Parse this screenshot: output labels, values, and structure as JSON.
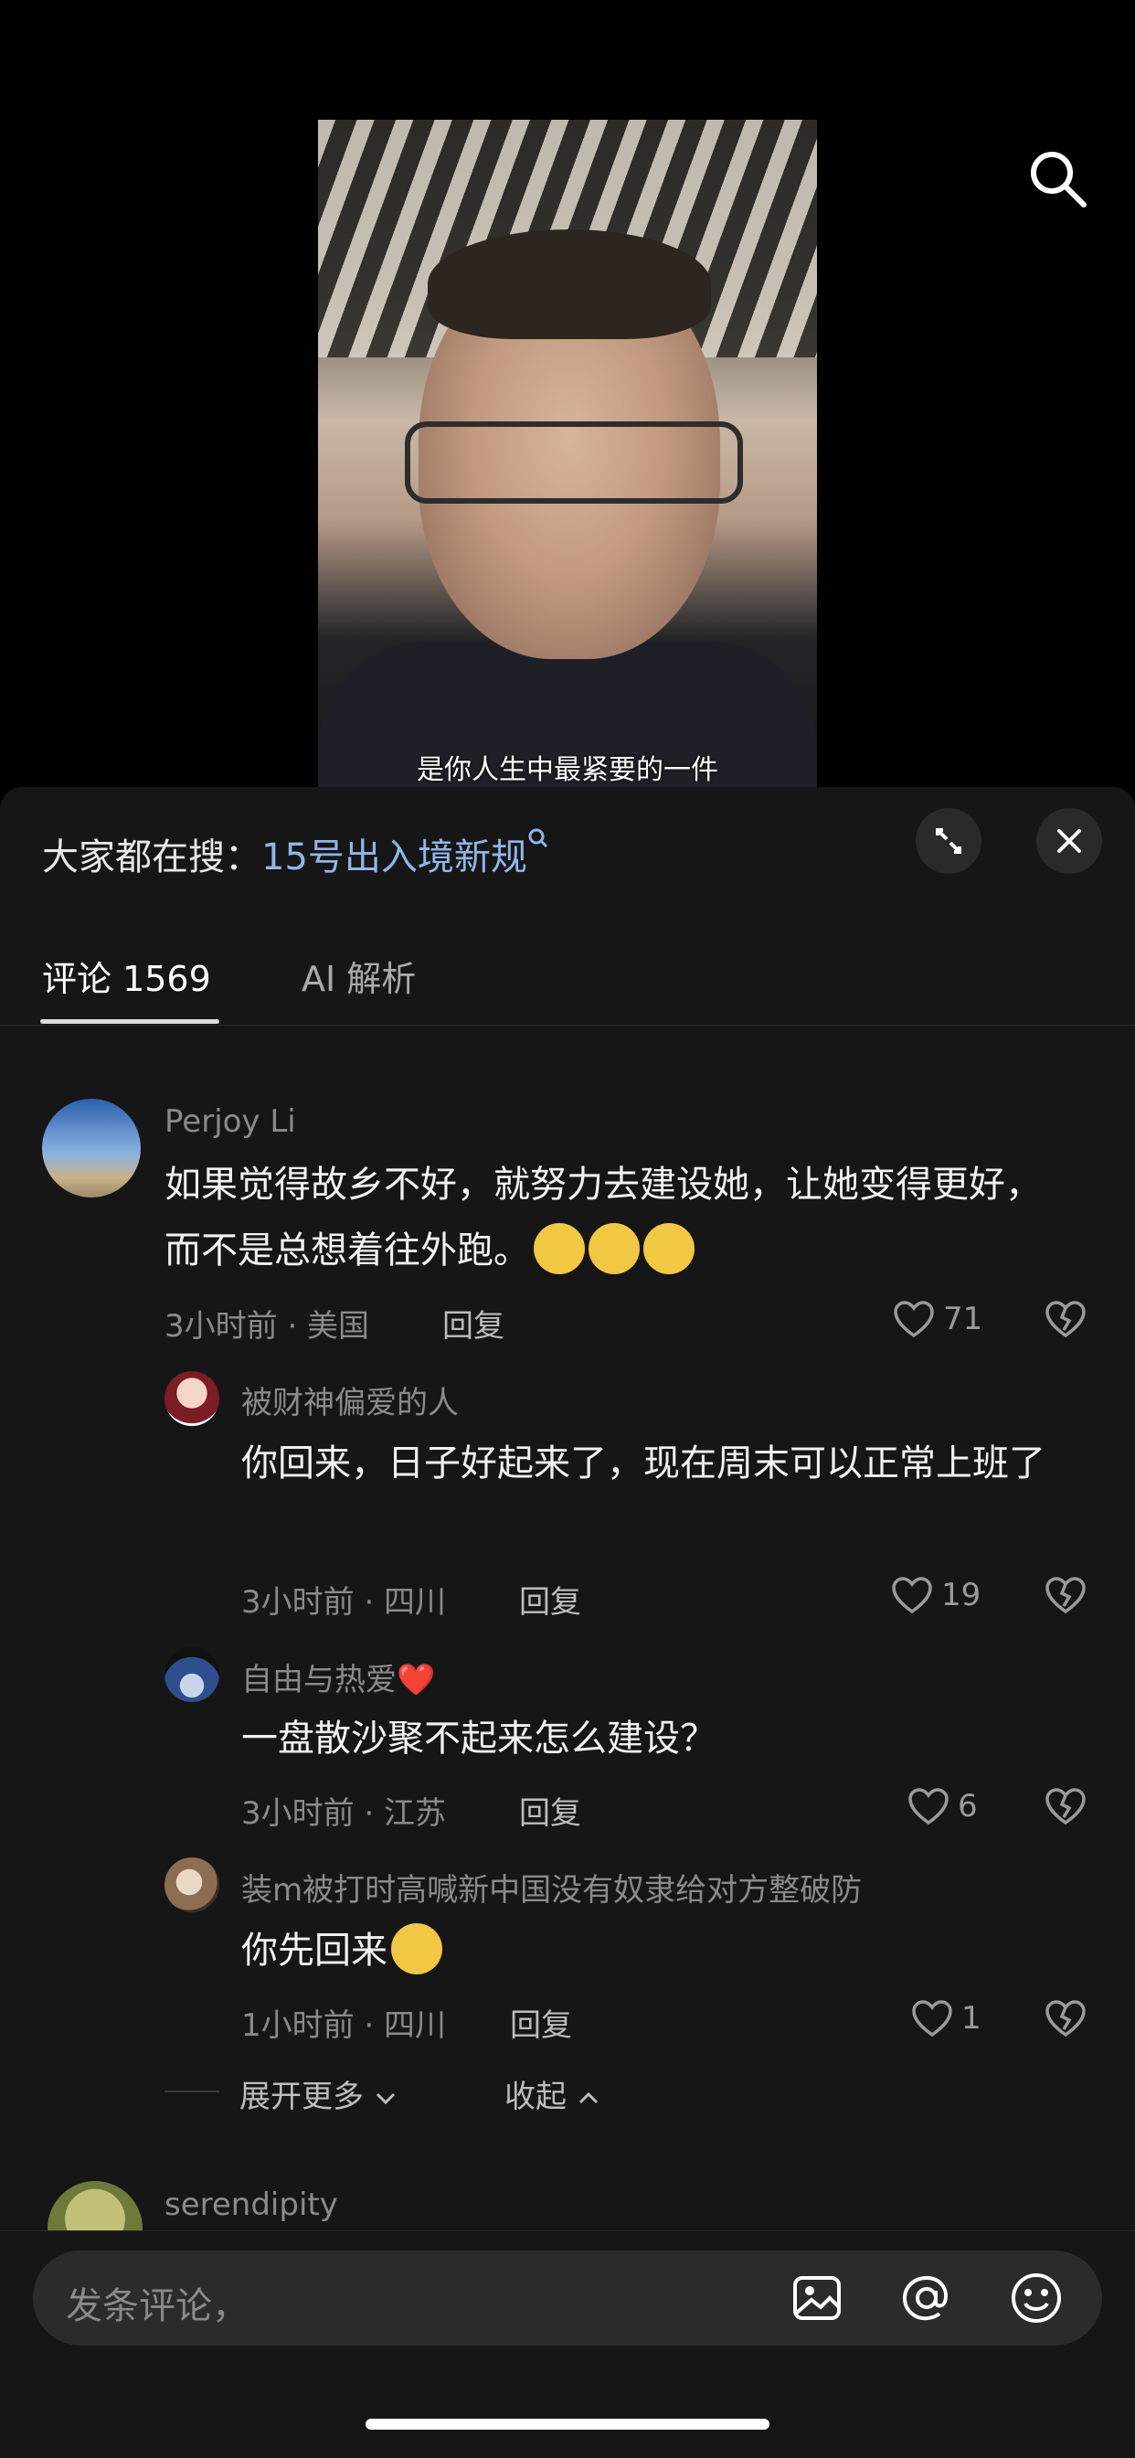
{
  "video": {
    "subtitle": "是你人生中最紧要的一件"
  },
  "trending": {
    "prefix": "大家都在搜：",
    "keyword": "15号出入境新规"
  },
  "tabs": {
    "comments": "评论 1569",
    "ai": "AI 解析"
  },
  "comments": [
    {
      "username": "Perjoy Li",
      "text": "如果觉得故乡不好，就努力去建设她，让她变得更好，而不是总想着往外跑。",
      "meta": "3小时前 · 美国",
      "reply": "回复",
      "likes": "71"
    },
    {
      "username": "被财神偏爱的人",
      "text": "你回来，日子好起来了，现在周末可以正常上班了",
      "meta": "3小时前 · 四川",
      "reply": "回复",
      "likes": "19"
    },
    {
      "username": "自由与热爱❤️",
      "text": "一盘散沙聚不起来怎么建设？",
      "meta": "3小时前 · 江苏",
      "reply": "回复",
      "likes": "6"
    },
    {
      "username": "装m被打时高喊新中国没有奴隶给对方整破防",
      "text": "你先回来",
      "meta": "1小时前 · 四川",
      "reply": "回复",
      "likes": "1"
    },
    {
      "username": "serendipity"
    }
  ],
  "thread": {
    "more": "展开更多",
    "collapse": "收起"
  },
  "input": {
    "placeholder": "发条评论，"
  },
  "colors": {
    "accent": "#8fb6ea",
    "heart_red": "#e8323c",
    "panel": "#161616"
  }
}
